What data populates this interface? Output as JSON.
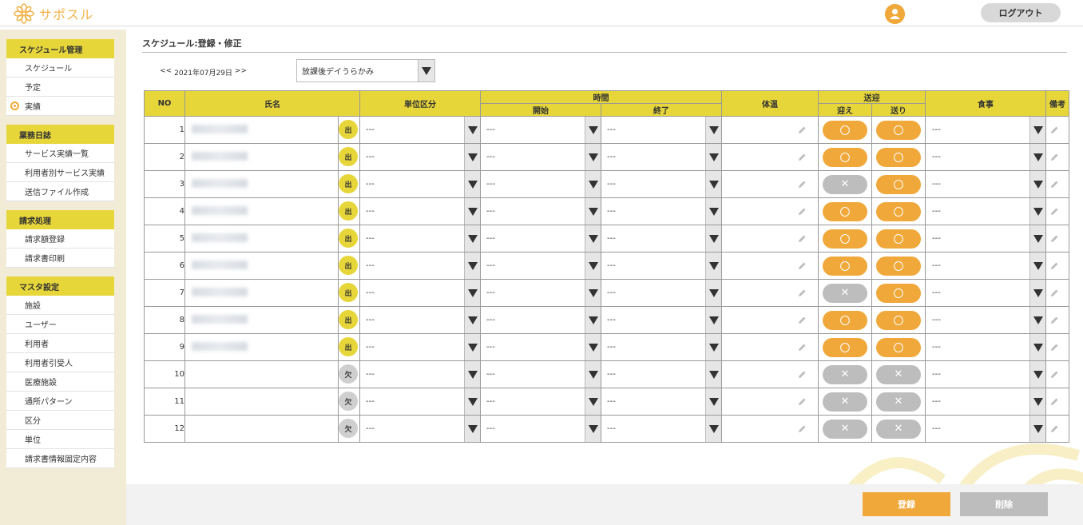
{
  "header": {
    "logo_text": "サポスル",
    "logout_label": "ログアウト",
    "brand_color": "#f0a83a"
  },
  "sidebar": {
    "groups": [
      {
        "title": "スケジュール管理",
        "items": [
          "スケジュール",
          "予定",
          "実績"
        ]
      },
      {
        "title": "業務日誌",
        "items": [
          "サービス実績一覧",
          "利用者別サービス実績",
          "送信ファイル作成"
        ]
      },
      {
        "title": "請求処理",
        "items": [
          "請求額登録",
          "請求書印刷"
        ]
      },
      {
        "title": "マスタ設定",
        "items": [
          "施設",
          "ユーザー",
          "利用者",
          "利用者引受人",
          "医療施設",
          "通所パターン",
          "区分",
          "単位",
          "請求書情報固定内容"
        ]
      }
    ],
    "active_item": "実績"
  },
  "main": {
    "title": "スケジュール:登録・修正",
    "date_prev": "<<",
    "date": "2021年07月29日",
    "date_next": ">>",
    "facility": "放課後デイうらかみ",
    "columns": {
      "no": "NO",
      "name": "氏名",
      "unit_class": "単位区分",
      "time": "時間",
      "start": "開始",
      "end": "終了",
      "temp": "体温",
      "transport": "送迎",
      "pickup": "迎え",
      "dropoff": "送り",
      "meal": "食事",
      "notes": "備考"
    },
    "placeholder": "---",
    "rows": [
      {
        "no": "1",
        "attendance": "出",
        "pickup": "yes",
        "dropoff": "yes"
      },
      {
        "no": "2",
        "attendance": "出",
        "pickup": "yes",
        "dropoff": "yes"
      },
      {
        "no": "3",
        "attendance": "出",
        "pickup": "no",
        "dropoff": "yes"
      },
      {
        "no": "4",
        "attendance": "出",
        "pickup": "yes",
        "dropoff": "yes"
      },
      {
        "no": "5",
        "attendance": "出",
        "pickup": "yes",
        "dropoff": "yes"
      },
      {
        "no": "6",
        "attendance": "出",
        "pickup": "yes",
        "dropoff": "yes"
      },
      {
        "no": "7",
        "attendance": "出",
        "pickup": "no",
        "dropoff": "yes"
      },
      {
        "no": "8",
        "attendance": "出",
        "pickup": "yes",
        "dropoff": "yes"
      },
      {
        "no": "9",
        "attendance": "出",
        "pickup": "yes",
        "dropoff": "yes"
      },
      {
        "no": "10",
        "attendance": "欠",
        "pickup": "no",
        "dropoff": "no"
      },
      {
        "no": "11",
        "attendance": "欠",
        "pickup": "no",
        "dropoff": "no"
      },
      {
        "no": "12",
        "attendance": "欠",
        "pickup": "no",
        "dropoff": "no"
      }
    ],
    "yes_mark": "〇",
    "no_mark": "✕"
  },
  "footer": {
    "register_label": "登録",
    "delete_label": "削除"
  }
}
